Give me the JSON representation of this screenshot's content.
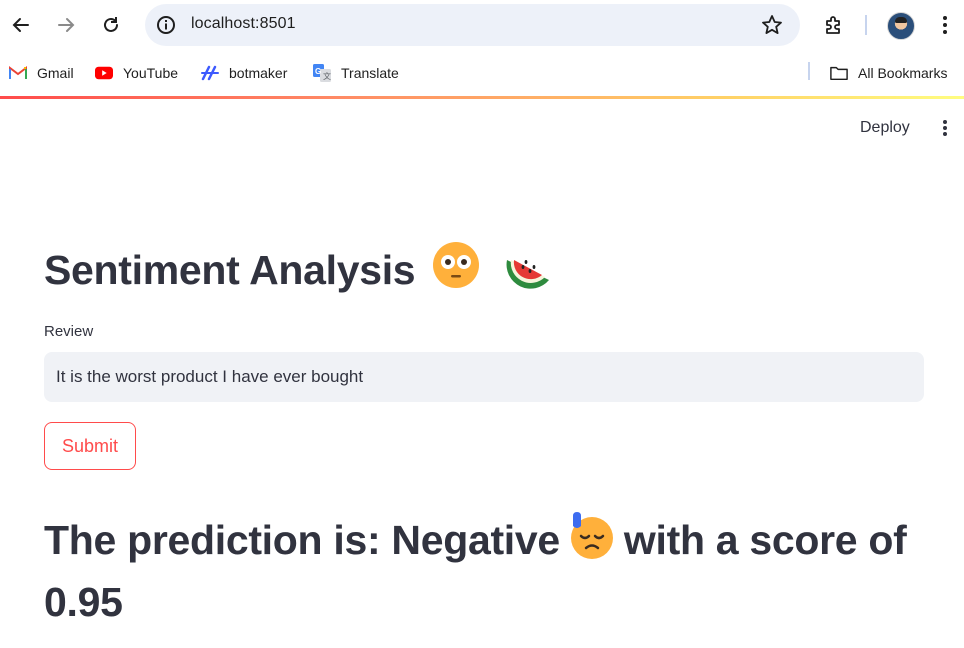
{
  "browser": {
    "url": "localhost:8501",
    "bookmarks": [
      {
        "label": "Gmail",
        "icon": "gmail-icon"
      },
      {
        "label": "YouTube",
        "icon": "youtube-icon"
      },
      {
        "label": "botmaker",
        "icon": "botmaker-icon"
      },
      {
        "label": "Translate",
        "icon": "translate-icon"
      }
    ],
    "all_bookmarks": "All Bookmarks"
  },
  "app": {
    "deploy_label": "Deploy",
    "title": "Sentiment Analysis",
    "title_emojis": [
      "flushed-face",
      "watermelon"
    ],
    "review_label": "Review",
    "review_value": "It is the worst product I have ever bought",
    "submit_label": "Submit",
    "result_prefix": "The prediction is: Negative",
    "result_emoji": "downcast-face-with-sweat",
    "result_suffix": "with a score of 0.95"
  },
  "colors": {
    "primary": "#ff4b4b",
    "text": "#31333f",
    "input_bg": "#f0f2f6"
  }
}
